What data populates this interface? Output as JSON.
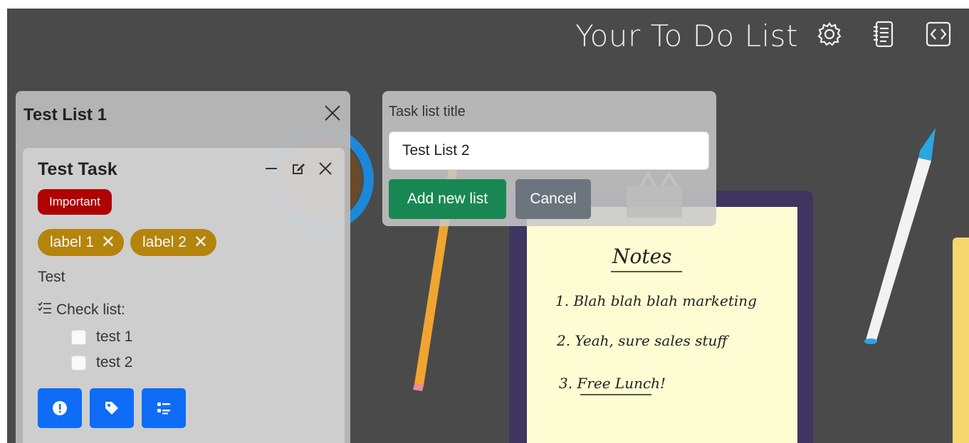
{
  "header": {
    "title": "Your To Do List"
  },
  "icons": {
    "settings": "gear-icon",
    "notes": "notebook-icon",
    "code": "code-brackets-icon"
  },
  "list": {
    "title": "Test List 1",
    "task": {
      "title": "Test Task",
      "priority_badge": "Important",
      "labels": [
        "label 1",
        "label 2"
      ],
      "description": "Test",
      "checklist_heading": "Check list:",
      "checklist_items": [
        "test 1",
        "test 2"
      ]
    }
  },
  "new_list_form": {
    "label": "Task list title",
    "input_value": "Test List 2",
    "add_button": "Add new list",
    "cancel_button": "Cancel"
  },
  "background_note": {
    "heading": "Notes",
    "lines": [
      "1. Blah blah blah marketing",
      "2. Yeah, sure sales stuff",
      "3. Free Lunch!"
    ]
  },
  "colors": {
    "background": "#4a4a4a",
    "important": "#b30000",
    "label": "#b8860b",
    "primary": "#0d6efd",
    "success": "#198754",
    "secondary": "#6c757d"
  }
}
